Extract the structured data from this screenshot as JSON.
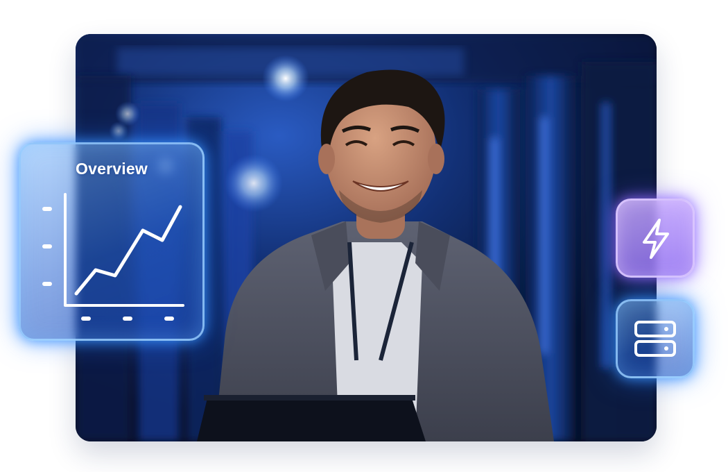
{
  "overview_card": {
    "title": "Overview"
  },
  "icons": {
    "chart": "line-chart-icon",
    "bolt": "lightning-bolt-icon",
    "server": "server-stack-icon"
  },
  "photo": {
    "subject": "person-with-lanyard"
  },
  "colors": {
    "glass_blue": "#3f8dff",
    "glass_purple": "#9b7bf5",
    "photo_background": "#0e2a66"
  }
}
